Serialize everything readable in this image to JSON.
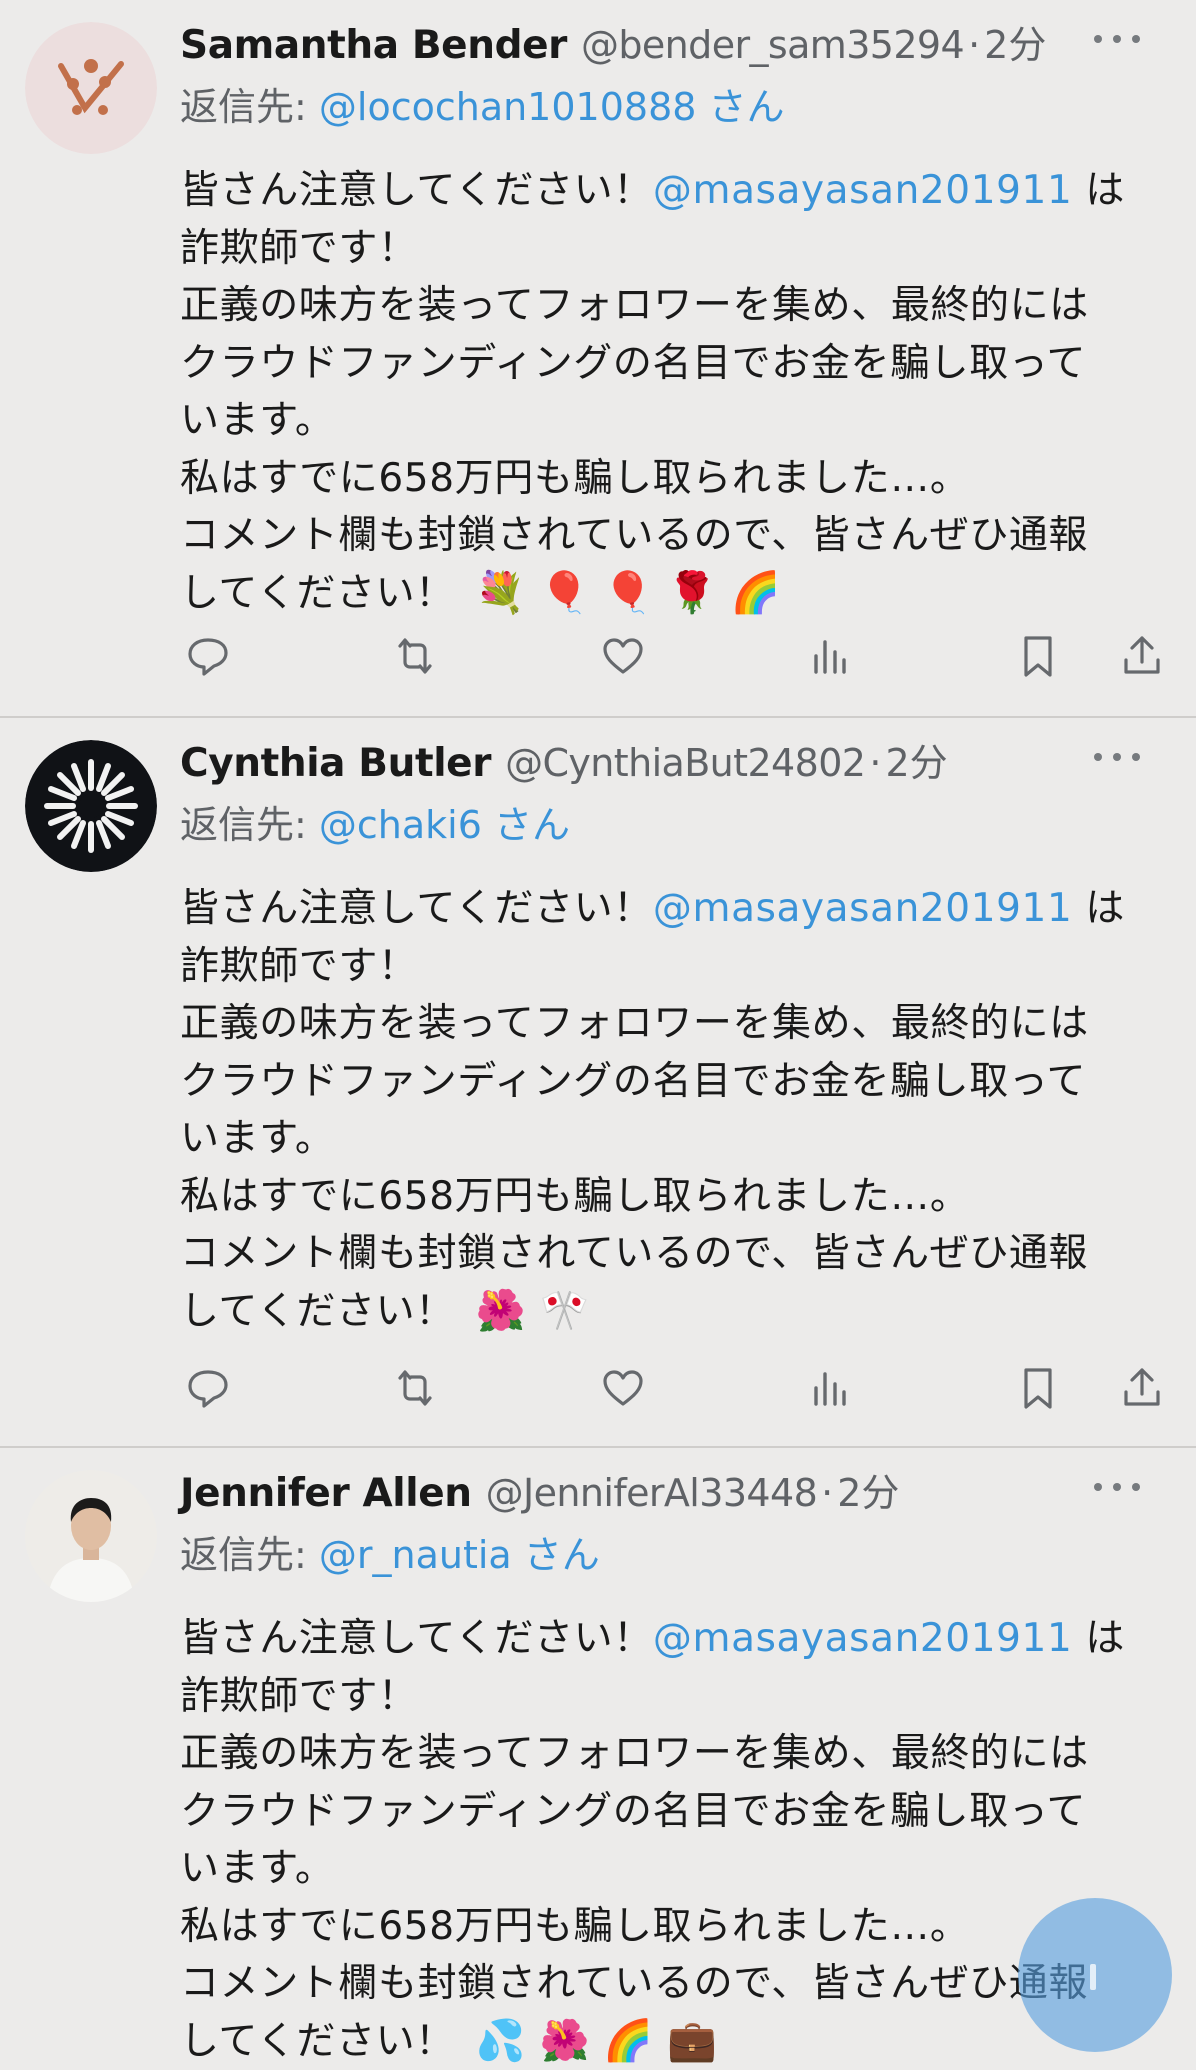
{
  "tweets": [
    {
      "name": "Samantha Bender",
      "handle": "@bender_sam35294",
      "time": "2分",
      "reply_prefix": "返信先: ",
      "reply_to": "@locochan1010888 さん",
      "text_before": "皆さん注意してください！",
      "mention": "@masayasan201911",
      "text_after": " は\n詐欺師です！\n正義の味方を装ってフォロワーを集め、最終的には\nクラウドファンディングの名目でお金を騙し取って\nいます。\n私はすでに658万円も騙し取られました…。\nコメント欄も封鎖されているので、皆さんぜひ通報\nしてください！",
      "emojis": "💐 🎈 🎈 🌹 🌈",
      "avatar_icon": "brand-logo-avatar"
    },
    {
      "name": "Cynthia Butler",
      "handle": "@CynthiaBut24802",
      "time": "2分",
      "reply_prefix": "返信先: ",
      "reply_to": "@chaki6 さん",
      "text_before": "皆さん注意してください！",
      "mention": "@masayasan201911",
      "text_after": " は\n詐欺師です！\n正義の味方を装ってフォロワーを集め、最終的には\nクラウドファンディングの名目でお金を騙し取って\nいます。\n私はすでに658万円も騙し取られました…。\nコメント欄も封鎖されているので、皆さんぜひ通報\nしてください！",
      "emojis": "🌺 🎌",
      "avatar_icon": "starburst-avatar"
    },
    {
      "name": "Jennifer Allen",
      "handle": "@JenniferAl33448",
      "time": "2分",
      "reply_prefix": "返信先: ",
      "reply_to": "@r_nautia さん",
      "text_before": "皆さん注意してください！",
      "mention": "@masayasan201911",
      "text_after": " は\n詐欺師です！\n正義の味方を装ってフォロワーを集め、最終的には\nクラウドファンディングの名目でお金を騙し取って\nいます。\n私はすでに658万円も騙し取られました…。\nコメント欄も封鎖されているので、皆さんぜひ通報\nしてください！",
      "emojis": "💦 🌺 🌈 💼",
      "avatar_icon": "person-photo-avatar"
    }
  ],
  "separator": "·",
  "colors": {
    "background": "#ecebea",
    "link": "#3a93d8",
    "muted": "#5f6266",
    "icon": "#66696d",
    "fab": "#58a0de"
  },
  "action_icons": [
    "reply-icon",
    "retweet-icon",
    "like-icon",
    "views-icon",
    "bookmark-icon",
    "share-icon"
  ],
  "fab_icon": "compose-icon"
}
